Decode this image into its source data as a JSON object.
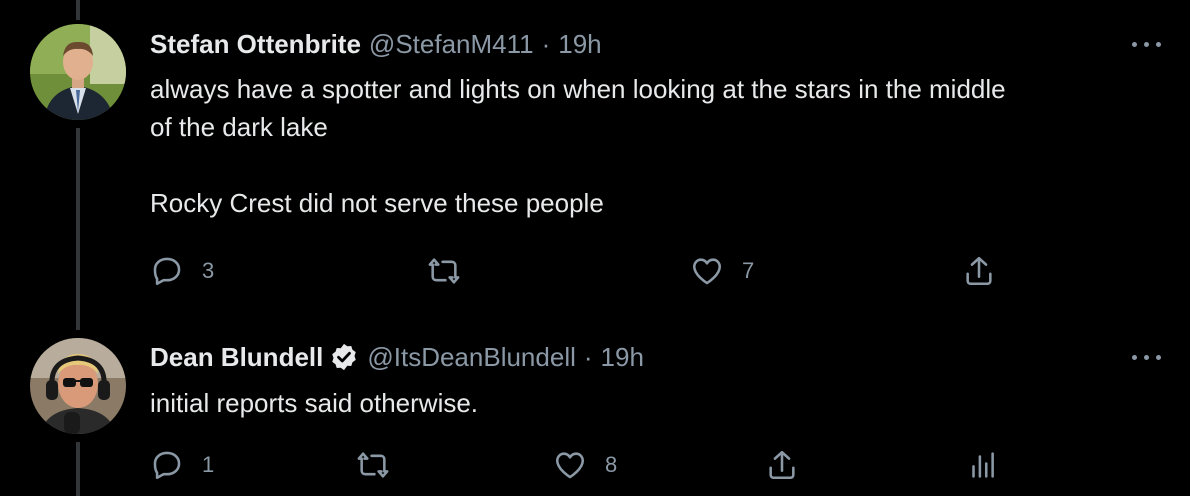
{
  "tweets": [
    {
      "display_name": "Stefan Ottenbrite",
      "handle": "@StefanM411",
      "separator": "·",
      "time": "19h",
      "verified": false,
      "lines": [
        "always have a spotter and lights on when looking at the stars in the middle",
        "of the dark lake",
        "",
        "Rocky Crest did not serve these people"
      ],
      "actions": {
        "reply_count": "3",
        "retweet_count": "",
        "like_count": "7"
      }
    },
    {
      "display_name": "Dean Blundell",
      "handle": "@ItsDeanBlundell",
      "separator": "·",
      "time": "19h",
      "verified": true,
      "lines": [
        "initial reports said otherwise."
      ],
      "actions": {
        "reply_count": "1",
        "retweet_count": "",
        "like_count": "8"
      }
    }
  ],
  "colors": {
    "background": "#000000",
    "text": "#e7e9ea",
    "secondary": "#8b98a5",
    "thread_line": "#333639"
  }
}
